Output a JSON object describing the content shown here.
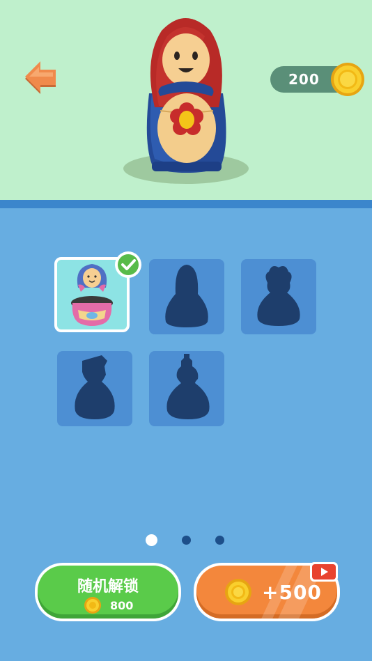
{
  "header": {
    "coin_balance": "200",
    "colors": {
      "top_bg": "#bff0cc",
      "pill": "#5a8f78",
      "back_arrow": "#f08a4b"
    }
  },
  "skins": {
    "selected_index": 0,
    "items": [
      {
        "state": "unlocked-selected"
      },
      {
        "state": "locked"
      },
      {
        "state": "locked"
      },
      {
        "state": "locked"
      },
      {
        "state": "locked"
      }
    ]
  },
  "pagination": {
    "pages": 3,
    "current": 1
  },
  "buttons": {
    "random_unlock_label": "随机解锁",
    "random_unlock_price": "800",
    "ad_reward_label": "+500"
  },
  "icons": [
    "back-arrow-icon",
    "coin-icon",
    "checkmark-icon",
    "video-play-icon"
  ]
}
